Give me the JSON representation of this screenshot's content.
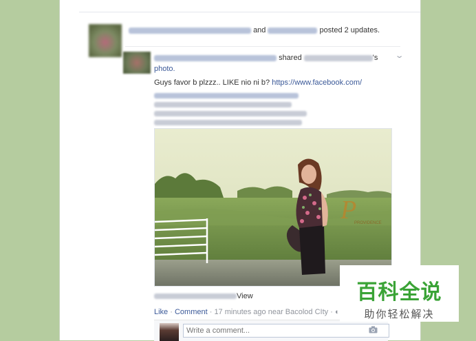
{
  "story": {
    "conjunction": "and",
    "action": "posted 2 updates."
  },
  "post": {
    "verb": "shared",
    "possessive": "'s",
    "photo_link": "photo.",
    "message": "Guys favor b plzzz.. LIKE nio ni b?",
    "url": "https://www.facebook.com/",
    "photo_caption_tail": "View",
    "photo_logo_letter": "P",
    "photo_logo_text": "PROVIDENCE"
  },
  "actions": {
    "like": "Like",
    "separator": " · ",
    "comment": "Comment",
    "timestamp": "17 minutes ago near Bacolod CIty",
    "trailing_separator": " · "
  },
  "comment": {
    "placeholder": "Write a comment..."
  },
  "watermark": {
    "brand": "百科全说",
    "slogan": "助你轻松解决"
  },
  "colors": {
    "background": "#b5cc9f",
    "link": "#3b5998",
    "brand_green": "#3aa336"
  },
  "icons": {
    "chevron": "chevron-down-icon",
    "globe": "globe-icon",
    "camera": "camera-icon"
  }
}
